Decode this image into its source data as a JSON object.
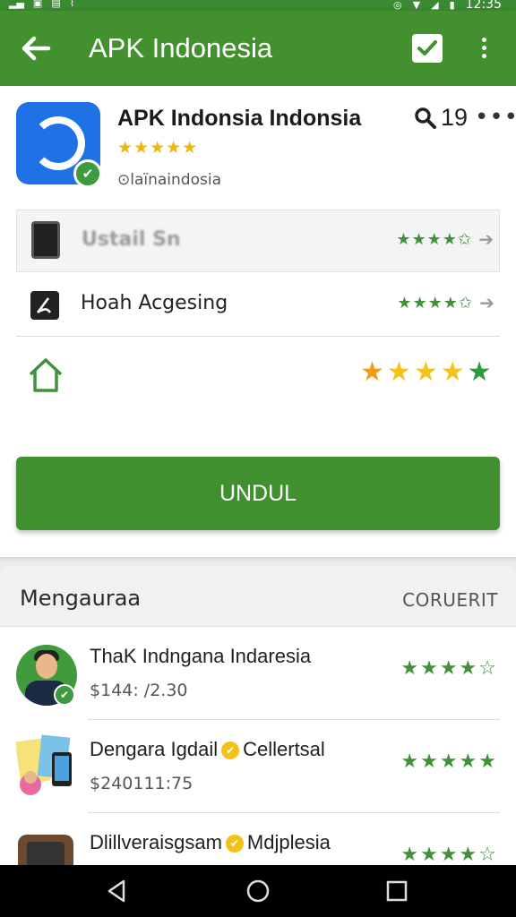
{
  "status_bar": {
    "time": "12:35"
  },
  "app_bar": {
    "title": "APK Indonesia"
  },
  "app": {
    "name": "APK Indonsia Indonsia",
    "stars": "★★★★★",
    "developer": "⊙laïnaindosia",
    "search_count": "19"
  },
  "rows": [
    {
      "label": "Ustail Sn",
      "stars": "★★★★✩",
      "blurred": true
    },
    {
      "label": "Hoah Acgesing",
      "stars": "★★★★✩"
    },
    {
      "icon": "home-icon",
      "stars": [
        "★",
        "★",
        "★",
        "★",
        "★"
      ]
    }
  ],
  "install": {
    "label": "UNDUL"
  },
  "section": {
    "title": "Mengauraa",
    "action": "CORUERIT"
  },
  "list": [
    {
      "title": "ThaK Indngana Indaresia",
      "subtitle": "$144: /2.30",
      "stars": "★★★★☆"
    },
    {
      "title_a": "Dengara Igdail",
      "title_b": "Cellertsal",
      "subtitle": "$240111:75",
      "stars": "★★★★★"
    },
    {
      "title_a": "Dlillveraisgsam",
      "title_b": "Mdjplesia",
      "subtitle": "",
      "stars": "★★★★☆"
    }
  ],
  "colors": {
    "primary": "#43902f",
    "accent_star": "#f2b50e",
    "rating_green": "#3f923a"
  }
}
